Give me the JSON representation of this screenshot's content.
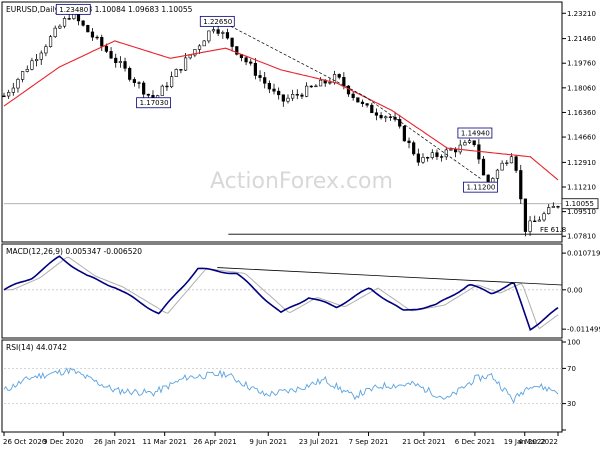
{
  "chart_data": [
    {
      "type": "candlestick",
      "header": "EURUSD,Daily  1.09833 1.10084 1.09683 1.10055",
      "watermark": "ActionForex.com",
      "y_ticks": [
        "1.23210",
        "1.21460",
        "1.19760",
        "1.18060",
        "1.16360",
        "1.14660",
        "1.12910",
        "1.11210",
        "1.09510",
        "1.07810"
      ],
      "y_tick_values": [
        1.2321,
        1.2146,
        1.1976,
        1.1806,
        1.1636,
        1.1466,
        1.1291,
        1.1121,
        1.0951,
        1.0781
      ],
      "ylim": [
        1.0755,
        1.2385
      ],
      "current_price_label": "1.10055",
      "current_price": 1.10055,
      "annotations": [
        {
          "text": "1.23480",
          "value": 1.2348,
          "t": 0.125
        },
        {
          "text": "1.17030",
          "value": 1.1703,
          "t": 0.27
        },
        {
          "text": "1.22650",
          "value": 1.2265,
          "t": 0.385
        },
        {
          "text": "1.14940",
          "value": 1.1494,
          "t": 0.85
        },
        {
          "text": "1.11200",
          "value": 1.112,
          "t": 0.86
        }
      ],
      "fib_label": "FE 61.8",
      "fib_level": 1.0795,
      "series": [
        {
          "name": "",
          "t": [
            0.0,
            0.12,
            0.27,
            0.38,
            0.5,
            0.6,
            0.65,
            0.7,
            0.75,
            0.85,
            0.87,
            0.92,
            0.94,
            1.0
          ],
          "values": [
            1.175,
            1.232,
            1.172,
            1.224,
            1.171,
            1.188,
            1.167,
            1.16,
            1.13,
            1.143,
            1.113,
            1.138,
            1.083,
            1.1
          ]
        },
        {
          "name": "",
          "t": [
            0.0,
            0.1,
            0.2,
            0.3,
            0.4,
            0.5,
            0.6,
            0.7,
            0.8,
            0.85,
            0.9,
            0.95,
            1.0
          ],
          "values": [
            1.168,
            1.195,
            1.213,
            1.201,
            1.208,
            1.193,
            1.184,
            1.165,
            1.139,
            1.137,
            1.135,
            1.133,
            1.117
          ]
        }
      ]
    },
    {
      "type": "line",
      "header": "MACD(12,26,9) 0.005347 -0.006520",
      "y_ticks": [
        "0.010719",
        "0.00",
        "-0.011499"
      ],
      "y_tick_values": [
        0.010719,
        0.0,
        -0.011499
      ],
      "ylim": [
        -0.0135,
        0.0128
      ],
      "series": [
        {
          "name": "",
          "t": [
            0.0,
            0.05,
            0.1,
            0.15,
            0.2,
            0.28,
            0.35,
            0.42,
            0.5,
            0.55,
            0.6,
            0.66,
            0.72,
            0.78,
            0.84,
            0.88,
            0.92,
            0.95,
            1.0
          ],
          "values": [
            0.0,
            0.0035,
            0.0097,
            0.004,
            0.0008,
            -0.007,
            0.0062,
            0.0048,
            -0.0068,
            -0.0022,
            -0.005,
            0.0005,
            -0.0062,
            -0.0045,
            0.0015,
            -0.001,
            0.002,
            -0.0115,
            -0.0055
          ]
        }
      ]
    },
    {
      "type": "line",
      "header": "RSI(14) 44.0742",
      "y_ticks": [
        "100",
        "70",
        "30",
        "0"
      ],
      "y_tick_values": [
        100,
        70,
        30,
        0
      ],
      "ylim": [
        0,
        100
      ],
      "series": [
        {
          "name": "",
          "t": [
            0.0,
            0.05,
            0.12,
            0.2,
            0.27,
            0.33,
            0.4,
            0.47,
            0.52,
            0.58,
            0.63,
            0.68,
            0.74,
            0.8,
            0.85,
            0.88,
            0.92,
            0.95,
            1.0
          ],
          "values": [
            45,
            60,
            68,
            45,
            42,
            60,
            64,
            40,
            45,
            57,
            38,
            50,
            52,
            35,
            58,
            62,
            34,
            52,
            44
          ]
        }
      ]
    }
  ],
  "x_axis": {
    "labels": [
      "26 Oct 2020",
      "9 Dec 2020",
      "26 Jan 2021",
      "11 Mar 2021",
      "26 Apr 2021",
      "9 Jun 2021",
      "23 Jul 2021",
      "7 Sep 2021",
      "21 Oct 2021",
      "6 Dec 2021",
      "19 Jan 2022",
      "4 Mar 2022"
    ],
    "label_t": [
      0.0,
      0.107,
      0.2,
      0.29,
      0.381,
      0.477,
      0.568,
      0.658,
      0.758,
      0.85,
      0.94,
      1.0
    ]
  },
  "colors": {
    "candles": "#000000",
    "moving_average": "#e8242b",
    "macd_line": "#000080",
    "signal_line": "#b0b0b0",
    "rsi_line": "#5ba3e0",
    "label_box_border": "#000080",
    "label_box_text": "#000080",
    "trendline": "#000000",
    "grid": "#c8c8c8"
  }
}
